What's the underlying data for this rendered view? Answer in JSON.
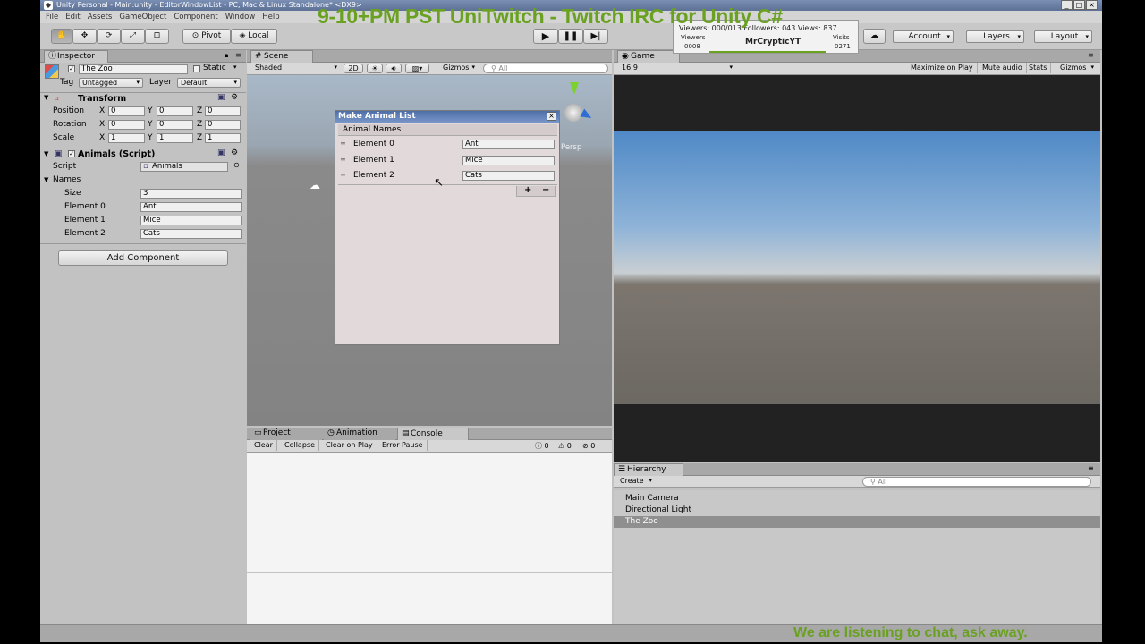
{
  "window": {
    "title": "Unity Personal - Main.unity - EditorWindowList - PC, Mac & Linux Standalone* <DX9>"
  },
  "menu": [
    "File",
    "Edit",
    "Assets",
    "GameObject",
    "Component",
    "Window",
    "Help"
  ],
  "toolbar": {
    "pivot": "Pivot",
    "local": "Local",
    "account": "Account",
    "layers": "Layers",
    "layout": "Layout"
  },
  "overlay": {
    "title": "9-10+PM PST UniTwitch - Twitch IRC for Unity C#",
    "viewers_line": "Viewers: 000/013  Followers: 043  Views: 837",
    "viewers_label": "Viewers",
    "viewers_value": "0008",
    "channel": "MrCrypticYT",
    "visits_label": "Visits",
    "visits_value": "0271",
    "footer": "We are listening to chat, ask away."
  },
  "inspector": {
    "tab": "Inspector",
    "object_name": "The Zoo",
    "static_label": "Static",
    "tag_label": "Tag",
    "tag_value": "Untagged",
    "layer_label": "Layer",
    "layer_value": "Default",
    "transform": {
      "title": "Transform",
      "rows": [
        {
          "label": "Position",
          "x": "0",
          "y": "0",
          "z": "0"
        },
        {
          "label": "Rotation",
          "x": "0",
          "y": "0",
          "z": "0"
        },
        {
          "label": "Scale",
          "x": "1",
          "y": "1",
          "z": "1"
        }
      ]
    },
    "script_component": {
      "title": "Animals (Script)",
      "script_label": "Script",
      "script_value": "Animals"
    },
    "names": {
      "title": "Names",
      "size_label": "Size",
      "size_value": "3",
      "elements": [
        {
          "label": "Element 0",
          "value": "Ant"
        },
        {
          "label": "Element 1",
          "value": "Mice"
        },
        {
          "label": "Element 2",
          "value": "Cats"
        }
      ]
    },
    "add_component": "Add Component"
  },
  "scene": {
    "tab": "Scene",
    "shading": "Shaded",
    "mode_2d": "2D",
    "gizmos": "Gizmos",
    "search": "All",
    "persp": "Persp"
  },
  "animal_window": {
    "title": "Make Animal List",
    "header": "Animal Names",
    "elements": [
      {
        "label": "Element 0",
        "value": "Ant"
      },
      {
        "label": "Element 1",
        "value": "Mice"
      },
      {
        "label": "Element 2",
        "value": "Cats"
      }
    ],
    "add": "+",
    "remove": "−"
  },
  "game": {
    "tab": "Game",
    "aspect": "16:9",
    "maximize": "Maximize on Play",
    "mute": "Mute audio",
    "stats": "Stats",
    "gizmos": "Gizmos"
  },
  "console": {
    "tabs": {
      "project": "Project",
      "animation": "Animation",
      "console": "Console"
    },
    "buttons": [
      "Clear",
      "Collapse",
      "Clear on Play",
      "Error Pause"
    ],
    "counts": {
      "info": "0",
      "warnings": "0",
      "errors": "0"
    }
  },
  "hierarchy": {
    "tab": "Hierarchy",
    "create": "Create",
    "search": "All",
    "items": [
      {
        "label": "Main Camera",
        "selected": false
      },
      {
        "label": "Directional Light",
        "selected": false
      },
      {
        "label": "The Zoo",
        "selected": true
      }
    ]
  },
  "colors": {
    "overlay_text": "#6aa121",
    "selection": "#8f8f8f"
  }
}
